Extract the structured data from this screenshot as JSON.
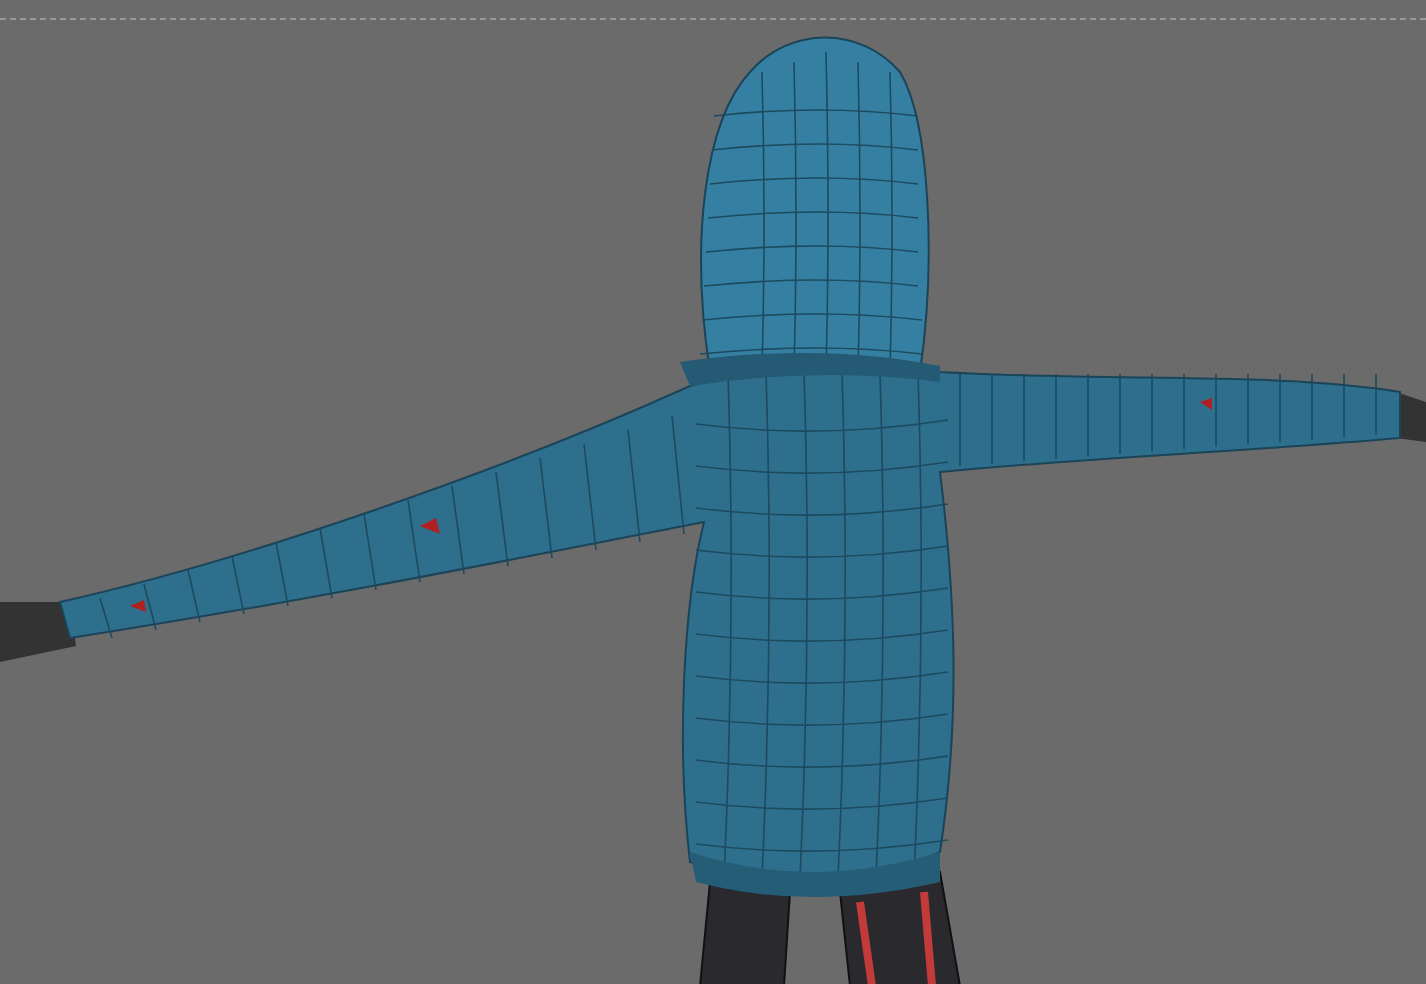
{
  "viewport": {
    "kind": "model-view"
  }
}
